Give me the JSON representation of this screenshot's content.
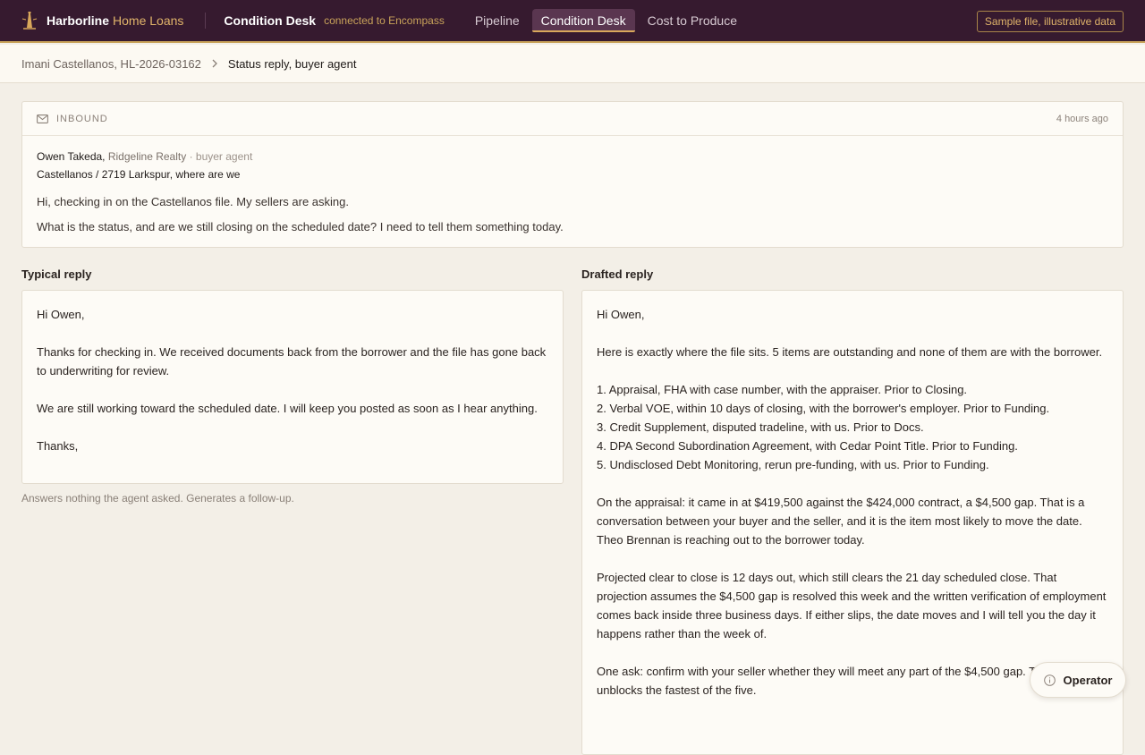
{
  "header": {
    "brand_name": "Harborline",
    "brand_sub": "Home Loans",
    "desk_title": "Condition Desk",
    "desk_status": "connected to Encompass",
    "tabs": [
      {
        "label": "Pipeline",
        "active": false
      },
      {
        "label": "Condition Desk",
        "active": true
      },
      {
        "label": "Cost to Produce",
        "active": false
      }
    ],
    "sample_badge": "Sample file, illustrative data",
    "colors": {
      "bar": "#361a2f",
      "accent": "#d9a85b"
    }
  },
  "breadcrumb": {
    "parent": "Imani Castellanos, HL-2026-03162",
    "separator": ">",
    "current": "Status reply, buyer agent"
  },
  "inbound": {
    "icon": "mail-icon",
    "label": "INBOUND",
    "time": "4 hours ago",
    "sender_name": "Owen Takeda",
    "sender_company": "Ridgeline Realty",
    "sender_role": "· buyer agent",
    "subject": "Castellanos / 2719 Larkspur, where are we",
    "lines": [
      "Hi, checking in on the Castellanos file. My sellers are asking.",
      "What is the status, and are we still closing on the scheduled date? I need to tell them something today."
    ]
  },
  "typical": {
    "label": "Typical reply",
    "greeting": "Hi Owen,",
    "para1": "Thanks for checking in. We received documents back from the borrower and the file has gone back to underwriting for review.",
    "para2": "We are still working toward the scheduled date. I will keep you posted as soon as I hear anything.",
    "closing": "Thanks,",
    "note": "Answers nothing the agent asked. Generates a follow-up."
  },
  "drafted": {
    "label": "Drafted reply",
    "greeting": "Hi Owen,",
    "intro": "Here is exactly where the file sits. 5 items are outstanding and none of them are with the borrower.",
    "items": [
      "1. Appraisal, FHA with case number, with the appraiser. Prior to Closing.",
      "2. Verbal VOE, within 10 days of closing, with the borrower's employer. Prior to Funding.",
      "3. Credit Supplement, disputed tradeline, with us. Prior to Docs.",
      "4. DPA Second Subordination Agreement, with Cedar Point Title. Prior to Funding.",
      "5. Undisclosed Debt Monitoring, rerun pre-funding, with us. Prior to Funding."
    ],
    "appraisal_para": "On the appraisal: it came in at $419,500 against the $424,000 contract, a $4,500 gap. That is a conversation between your buyer and the seller, and it is the item most likely to move the date. Theo Brennan is reaching out to the borrower today.",
    "projection_para": "Projected clear to close is 12 days out, which still clears the 21 day scheduled close. That projection assumes the $4,500 gap is resolved this week and the written verification of employment comes back inside three business days. If either slips, the date moves and I will tell you the day it happens rather than the week of.",
    "ask_para": "One ask: confirm with your seller whether they will meet any part of the $4,500 gap. That answer unblocks the fastest of the five."
  },
  "operator": {
    "icon": "info-icon",
    "label": "Operator"
  }
}
